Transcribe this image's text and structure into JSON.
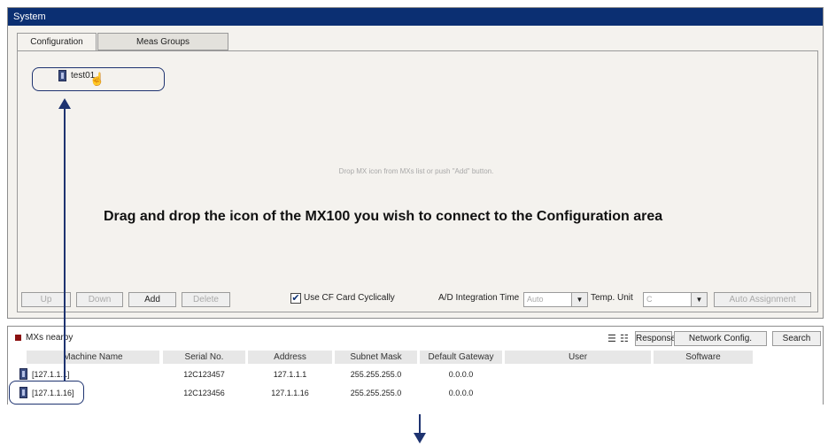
{
  "window": {
    "title": "System"
  },
  "tabs": [
    {
      "label": "Configuration"
    },
    {
      "label": "Meas Groups"
    }
  ],
  "config_area": {
    "device_label": "test01",
    "drop_hint": "Drop MX icon from MXs list or push \"Add\" button.",
    "instruction": "Drag and drop the icon of the MX100 you wish to connect to the Configuration area"
  },
  "toolbar": {
    "up_label": "Up",
    "down_label": "Down",
    "add_label": "Add",
    "delete_label": "Delete",
    "cf_checked": true,
    "cf_label": "Use CF Card Cyclically",
    "ad_label": "A/D Integration Time",
    "ad_value": "Auto",
    "temp_label": "Temp. Unit",
    "temp_value": "C",
    "auto_assignment_label": "Auto Assignment"
  },
  "mx_list": {
    "title": "MXs nearby",
    "response_label": "Response",
    "network_config_label": "Network Config.",
    "search_label": "Search",
    "columns": [
      "Machine Name",
      "Serial No.",
      "Address",
      "Subnet Mask",
      "Default Gateway",
      "User",
      "Software"
    ],
    "rows": [
      {
        "name": "[127.1.1.1]",
        "serial": "12C123457",
        "address": "127.1.1.1",
        "subnet": "255.255.255.0",
        "gateway": "0.0.0.0"
      },
      {
        "name": "[127.1.1.16]",
        "serial": "12C123456",
        "address": "127.1.1.16",
        "subnet": "255.255.255.0",
        "gateway": "0.0.0.0"
      }
    ]
  },
  "colors": {
    "title_bar": "#0b2f72",
    "annotation": "#1e3370",
    "hint_text": "#a8a8a8"
  },
  "icons": [
    "mx-device-icon",
    "hand-cursor-icon",
    "list-view-icon",
    "detail-view-icon",
    "checkbox-checked-icon",
    "dropdown-arrow-icon"
  ]
}
